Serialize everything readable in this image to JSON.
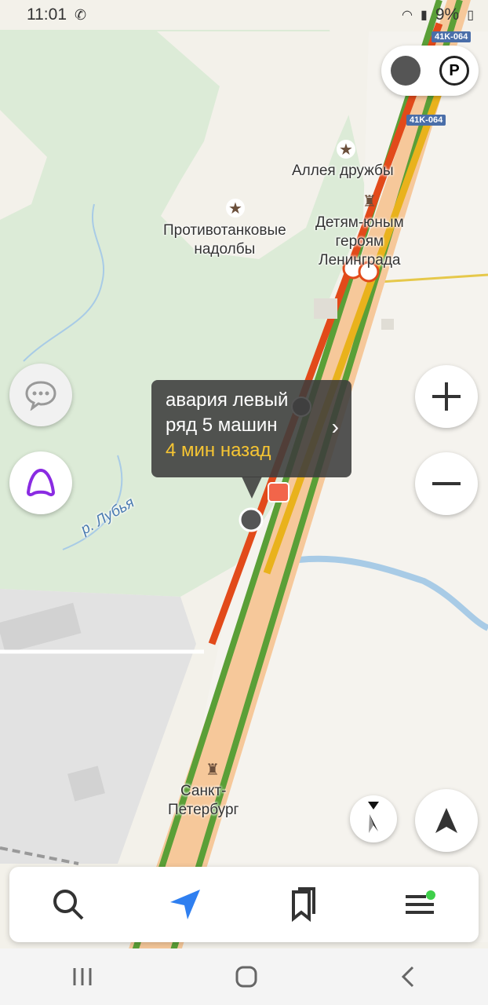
{
  "status": {
    "time": "11:01",
    "battery": "9%"
  },
  "road_shields": {
    "top": "41K-064",
    "second": "41K-064"
  },
  "places": {
    "alley": "Аллея дружбы",
    "antitank_line1": "Противотанковые",
    "antitank_line2": "надолбы",
    "heroes_line1": "Детям-юным",
    "heroes_line2": "героям",
    "heroes_line3": "Ленинграда",
    "river": "р. Лубья",
    "spb_line1": "Санкт-",
    "spb_line2": "Петербург"
  },
  "incident": {
    "line1": "авария левый",
    "line2": "ряд 5 машин",
    "time": "4 мин назад"
  },
  "colors": {
    "accent": "#2f7ff0",
    "traffic_red": "#e24a1a",
    "traffic_yellow": "#e9b21c",
    "traffic_green": "#5a9f37",
    "alice": "#8a2be2"
  },
  "icons": {
    "layers": "layers-icon",
    "parking": "parking-icon",
    "zoom_in": "plus-icon",
    "zoom_out": "minus-icon",
    "compass": "compass-icon",
    "location": "navigation-arrow-icon",
    "chat": "chat-bubble-icon",
    "alice": "alice-assistant-icon",
    "search": "search-icon",
    "route": "route-arrow-icon",
    "bookmarks": "bookmarks-icon",
    "menu": "menu-icon"
  }
}
